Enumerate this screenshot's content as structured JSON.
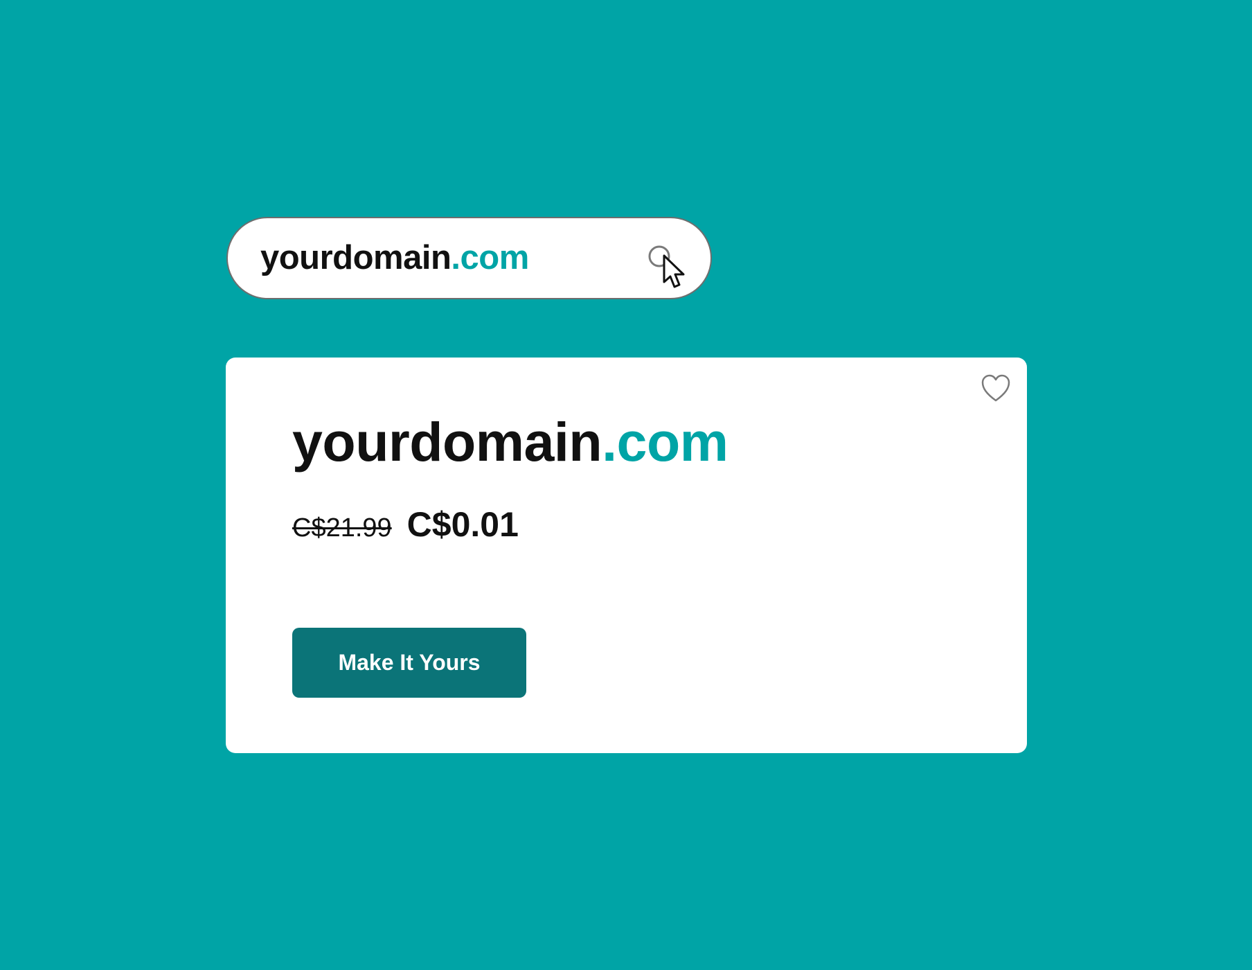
{
  "colors": {
    "background": "#00A4A6",
    "accent": "#00A4A6",
    "text": "#111111",
    "button": "#0B7478",
    "button_text": "#FFFFFF",
    "icon_stroke": "#7A7A7A"
  },
  "search": {
    "query_name": "yourdomain",
    "query_tld": ".com",
    "search_icon": "search-icon",
    "cursor_icon": "cursor-arrow-icon"
  },
  "card": {
    "favorite_icon": "heart-icon",
    "domain_name": "yourdomain",
    "domain_tld": ".com",
    "old_price": "C$21.99",
    "new_price": "C$0.01",
    "button_label": "Make It Yours"
  }
}
